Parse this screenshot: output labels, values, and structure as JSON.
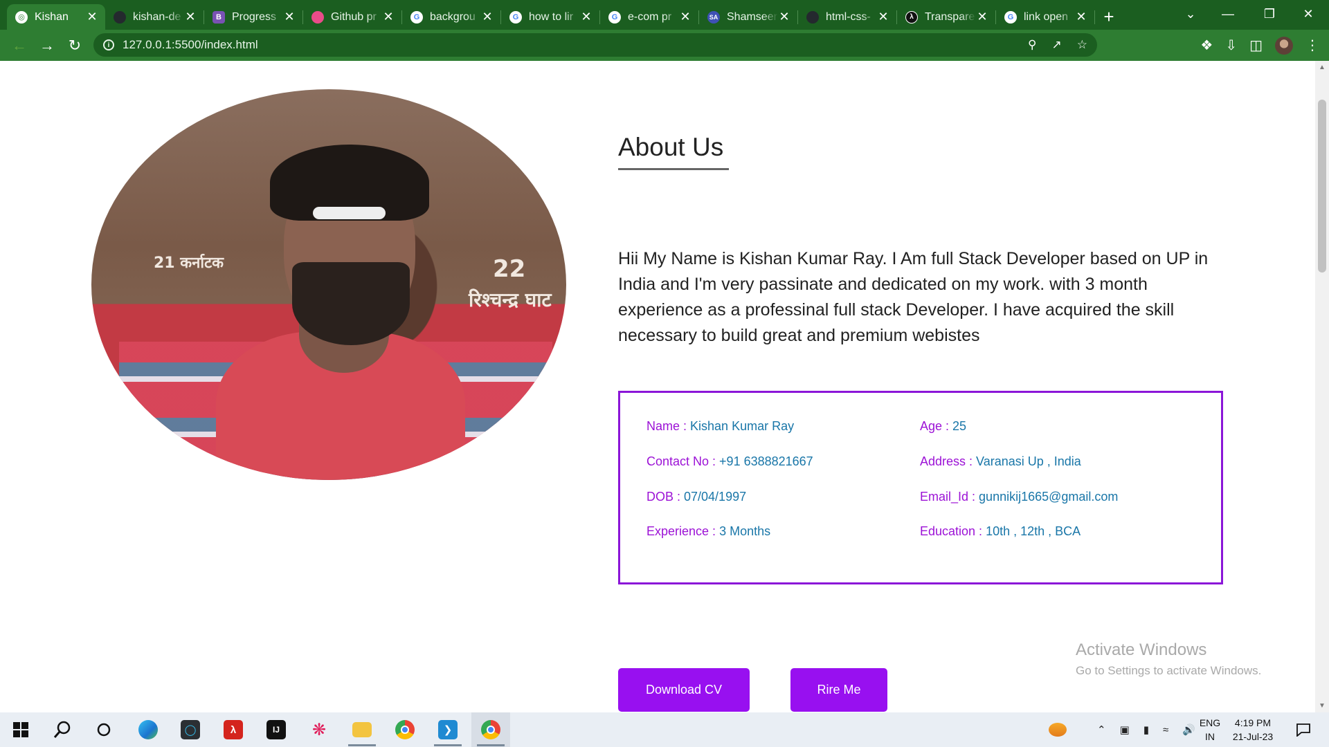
{
  "browser": {
    "tabs": [
      {
        "title": "Kishan",
        "icon": "globe-icon",
        "color": "#ffffff",
        "active": true
      },
      {
        "title": "kishan-de",
        "icon": "github-icon",
        "color": "#24292e"
      },
      {
        "title": "Progress",
        "icon": "bootstrap-icon",
        "color": "#7952b3"
      },
      {
        "title": "Github pr",
        "icon": "dribbble-icon",
        "color": "#ea4c89"
      },
      {
        "title": "backgrou",
        "icon": "google-icon",
        "color": "#4285f4"
      },
      {
        "title": "how to lir",
        "icon": "google-icon",
        "color": "#4285f4"
      },
      {
        "title": "e-com pr",
        "icon": "google-icon",
        "color": "#4285f4"
      },
      {
        "title": "Shamseer",
        "icon": "avatar-sa-icon",
        "color": "#3f51b5"
      },
      {
        "title": "html-css-",
        "icon": "github-icon",
        "color": "#24292e"
      },
      {
        "title": "Transpare",
        "icon": "lambda-icon",
        "color": "#111111"
      },
      {
        "title": "link open",
        "icon": "google-icon",
        "color": "#4285f4"
      }
    ],
    "url": "127.0.0.1:5500/index.html",
    "accent": "#2e7d32"
  },
  "page": {
    "about_title": "About Us",
    "about_text": "Hii My Name is Kishan Kumar Ray. I Am full Stack Developer based on UP in India and I'm very passinate and dedicated on my work. with 3 month experience as a professinal full stack Developer. I have acquired the skill necessary to build great and premium webistes",
    "photo_sign_1": "21 कर्नाटक",
    "photo_sign_2": "22",
    "photo_sign_3": "रिश्चन्द्र घाट",
    "info": [
      {
        "label": "Name : ",
        "value": "Kishan Kumar Ray"
      },
      {
        "label": "Age : ",
        "value": "25"
      },
      {
        "label": "Contact No : ",
        "value": "+91 6388821667"
      },
      {
        "label": "Address : ",
        "value": "Varanasi Up , India"
      },
      {
        "label": "DOB : ",
        "value": "07/04/1997"
      },
      {
        "label": "Email_Id : ",
        "value": "gunnikij1665@gmail.com"
      },
      {
        "label": "Experience : ",
        "value": "3 Months"
      },
      {
        "label": "Education : ",
        "value": "10th , 12th , BCA"
      }
    ],
    "buttons": {
      "download": "Download CV",
      "hire": "Rire Me"
    },
    "label_color": "#9c12d6",
    "value_color": "#1976a8",
    "button_color": "#9810f0"
  },
  "watermark": {
    "line1": "Activate Windows",
    "line2": "Go to Settings to activate Windows."
  },
  "taskbar": {
    "apps": [
      "start-icon",
      "search-icon",
      "cortana-icon",
      "edge-icon",
      "app-icon",
      "acrobat-icon",
      "intellij-icon",
      "slack-icon",
      "file-explorer-icon",
      "chrome-icon",
      "vscode-icon",
      "chrome-profile-icon"
    ],
    "lang_1": "ENG",
    "lang_2": "IN",
    "time": "4:19 PM",
    "date": "21-Jul-23"
  }
}
